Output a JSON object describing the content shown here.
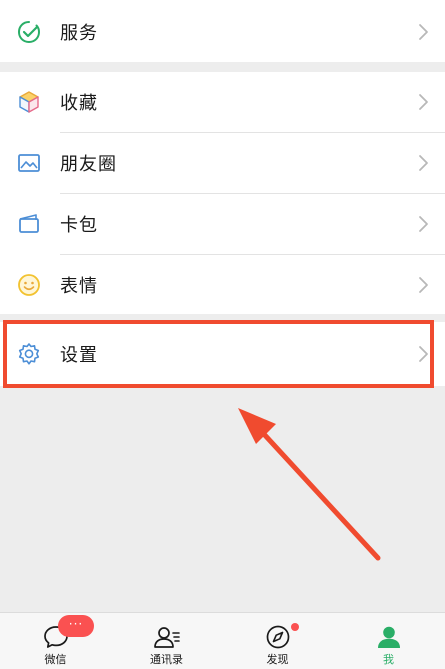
{
  "menu": {
    "service": {
      "label": "服务",
      "icon": "service-icon"
    },
    "favorites": {
      "label": "收藏",
      "icon": "cube-icon"
    },
    "moments": {
      "label": "朋友圈",
      "icon": "image-icon"
    },
    "cards": {
      "label": "卡包",
      "icon": "wallet-icon"
    },
    "stickers": {
      "label": "表情",
      "icon": "smiley-icon"
    },
    "settings": {
      "label": "设置",
      "icon": "gear-icon"
    }
  },
  "tabbar": {
    "chats": {
      "label": "微信",
      "badge": "···"
    },
    "contacts": {
      "label": "通讯录"
    },
    "discover": {
      "label": "发现"
    },
    "me": {
      "label": "我"
    }
  },
  "colors": {
    "accent_green": "#2aae67",
    "highlight_red": "#f04b2f",
    "badge_red": "#fa5151",
    "icon_blue": "#4c8ed6"
  }
}
